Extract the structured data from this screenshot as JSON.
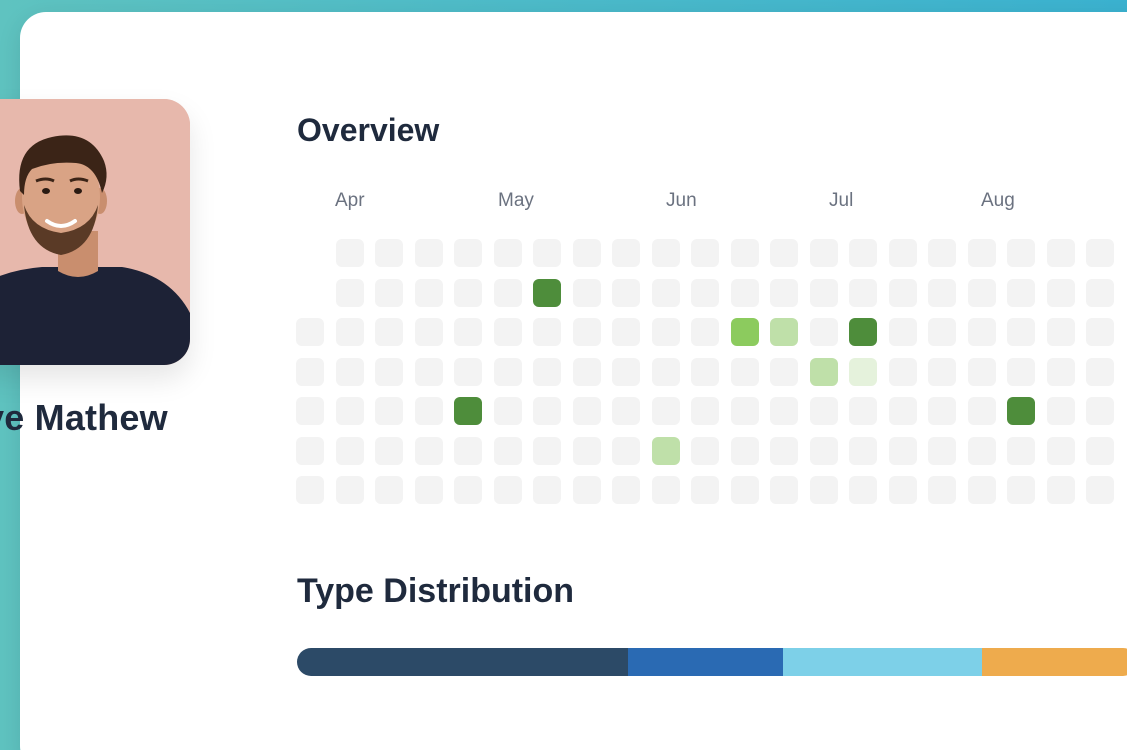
{
  "profile": {
    "name": "ve Mathew"
  },
  "overview": {
    "title": "Overview",
    "months": [
      "Apr",
      "May",
      "Jun",
      "Jul",
      "Aug"
    ],
    "colors": {
      "0": "#f3f3f3",
      "1": "#e5f2dc",
      "2": "#bfe0a9",
      "3": "#8ccb5e",
      "4": "#4e8d3b"
    },
    "activity_rows": [
      [
        null,
        0,
        0,
        0,
        0,
        0,
        0,
        0,
        0,
        0,
        0,
        0,
        0,
        0,
        0,
        0,
        0,
        0,
        0,
        0,
        0
      ],
      [
        null,
        0,
        0,
        0,
        0,
        0,
        4,
        0,
        0,
        0,
        0,
        0,
        0,
        0,
        0,
        0,
        0,
        0,
        0,
        0,
        0
      ],
      [
        0,
        0,
        0,
        0,
        0,
        0,
        0,
        0,
        0,
        0,
        0,
        3,
        2,
        0,
        4,
        0,
        0,
        0,
        0,
        0,
        0
      ],
      [
        0,
        0,
        0,
        0,
        0,
        0,
        0,
        0,
        0,
        0,
        0,
        0,
        0,
        2,
        1,
        0,
        0,
        0,
        0,
        0,
        0
      ],
      [
        0,
        0,
        0,
        0,
        4,
        0,
        0,
        0,
        0,
        0,
        0,
        0,
        0,
        0,
        0,
        0,
        0,
        0,
        4,
        0,
        0
      ],
      [
        0,
        0,
        0,
        0,
        0,
        0,
        0,
        0,
        0,
        2,
        0,
        0,
        0,
        0,
        0,
        0,
        0,
        0,
        0,
        0,
        0
      ],
      [
        0,
        0,
        0,
        0,
        0,
        0,
        0,
        0,
        0,
        0,
        0,
        0,
        0,
        0,
        0,
        0,
        0,
        0,
        0,
        0,
        0
      ]
    ]
  },
  "type_distribution": {
    "title": "Type Distribution",
    "segments": [
      {
        "share": 0.394,
        "color": "#2c4a67"
      },
      {
        "share": 0.185,
        "color": "#2a6ab3"
      },
      {
        "share": 0.236,
        "color": "#7dd0e8"
      },
      {
        "share": 0.185,
        "color": "#eeab4d"
      }
    ]
  }
}
